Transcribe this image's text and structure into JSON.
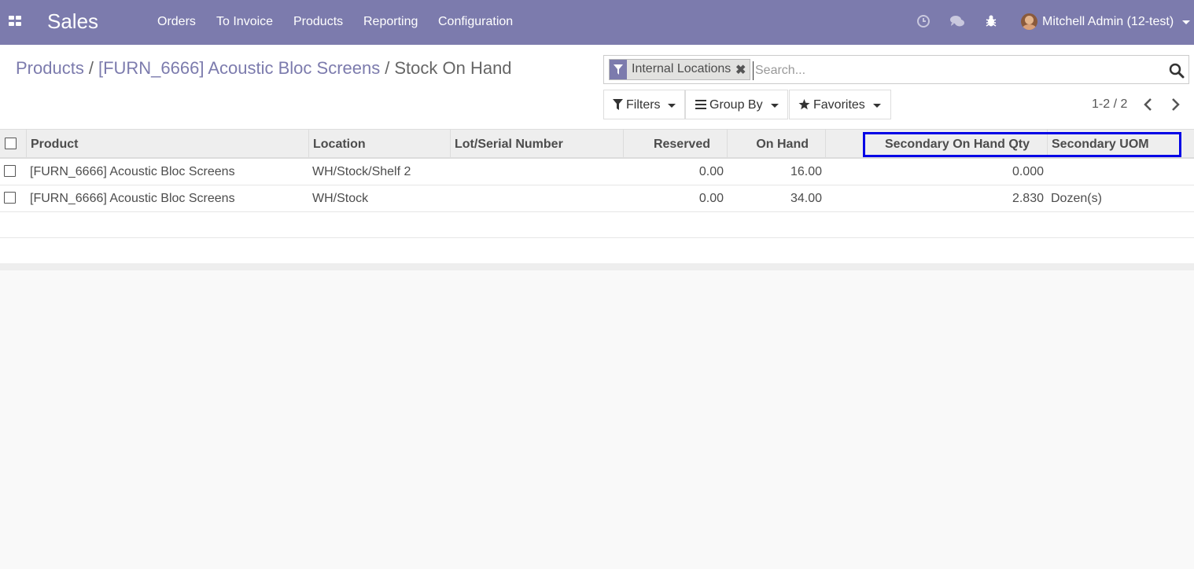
{
  "navbar": {
    "app_name": "Sales",
    "menu": [
      "Orders",
      "To Invoice",
      "Products",
      "Reporting",
      "Configuration"
    ],
    "icons": [
      "clock-icon",
      "chat-icon",
      "bug-icon"
    ],
    "user": "Mitchell Admin (12-test)",
    "bg_color": "#7c7bad"
  },
  "breadcrumb": {
    "items": [
      "Products",
      "[FURN_6666] Acoustic Bloc Screens"
    ],
    "separator": "/",
    "current": "Stock On Hand"
  },
  "search": {
    "facet": "Internal Locations",
    "facet_remove": "✖",
    "placeholder": "Search..."
  },
  "toolbar": {
    "filters": "Filters",
    "group_by": "Group By",
    "favorites": "Favorites"
  },
  "pager": {
    "value": "1-2 / 2"
  },
  "table": {
    "columns": [
      "Product",
      "Location",
      "Lot/Serial Number",
      "Reserved",
      "On Hand",
      "Secondary On Hand Qty",
      "Secondary UOM"
    ],
    "rows": [
      {
        "product": "[FURN_6666] Acoustic Bloc Screens",
        "location": "WH/Stock/Shelf 2",
        "lot": "",
        "reserved": "0.00",
        "on_hand": "16.00",
        "secondary_qty": "0.000",
        "secondary_uom": ""
      },
      {
        "product": "[FURN_6666] Acoustic Bloc Screens",
        "location": "WH/Stock",
        "lot": "",
        "reserved": "0.00",
        "on_hand": "34.00",
        "secondary_qty": "2.830",
        "secondary_uom": "Dozen(s)"
      }
    ]
  },
  "highlight_color": "#0000e6"
}
